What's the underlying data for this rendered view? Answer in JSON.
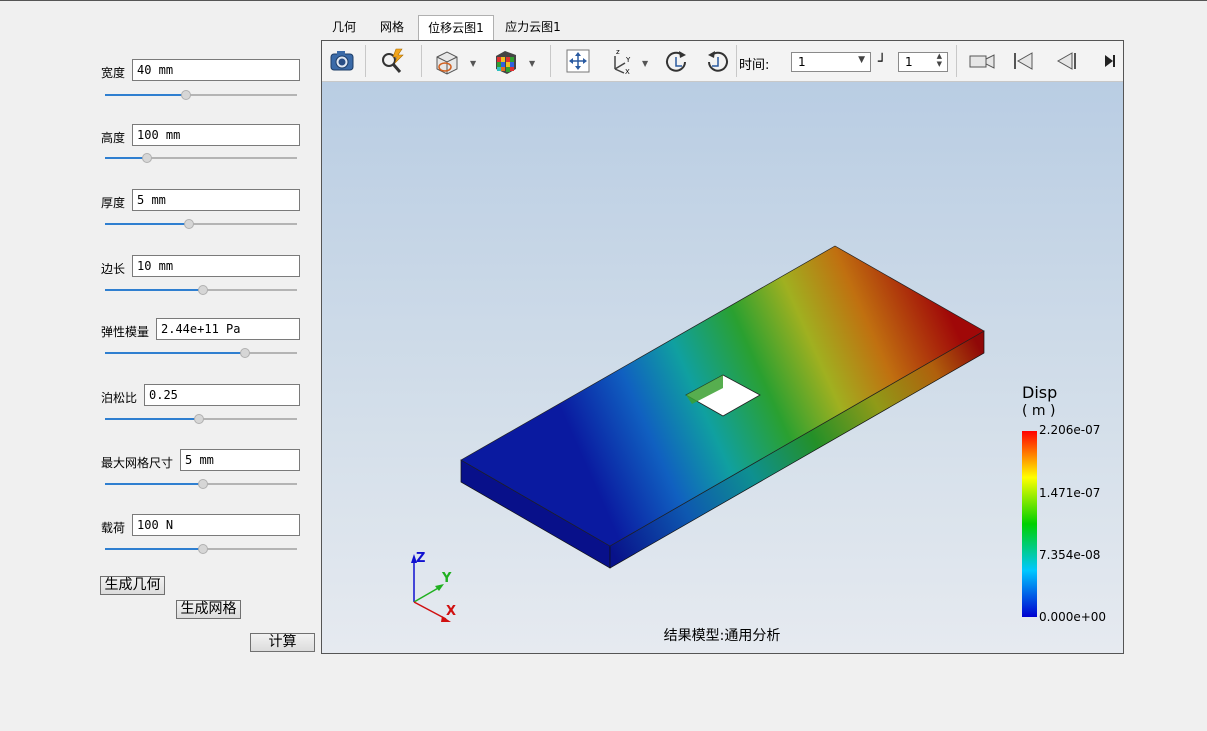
{
  "tabs": [
    {
      "label": "几何"
    },
    {
      "label": "网格"
    },
    {
      "label": "位移云图1"
    },
    {
      "label": "应力云图1"
    }
  ],
  "params": {
    "width": {
      "label": "宽度",
      "value": "40 mm",
      "slider": 0.42
    },
    "height": {
      "label": "高度",
      "value": "100 mm",
      "slider": 0.22
    },
    "thickness": {
      "label": "厚度",
      "value": "5 mm",
      "slider": 0.44
    },
    "side": {
      "label": "边长",
      "value": "10 mm",
      "slider": 0.51
    },
    "modulus": {
      "label": "弹性模量",
      "value": "2.44e+11 Pa",
      "slider": 0.73
    },
    "poisson": {
      "label": "泊松比",
      "value": "0.25",
      "slider": 0.49
    },
    "mesh": {
      "label": "最大网格尺寸",
      "value": "5 mm",
      "slider": 0.51
    },
    "load": {
      "label": "载荷",
      "value": "100 N",
      "slider": 0.51
    }
  },
  "buttons": {
    "gen_geometry": "生成几何",
    "gen_mesh": "生成网格",
    "compute": "计算"
  },
  "toolbar": {
    "time_label": "时间:",
    "time_value": "1",
    "step_value": "1"
  },
  "scene": {
    "caption": "结果模型:通用分析",
    "legend_title": "Disp",
    "legend_unit": "( m )",
    "legend_ticks": [
      "2.206e-07",
      "1.471e-07",
      "7.354e-08",
      "0.000e+00"
    ],
    "axes": {
      "z": "Z",
      "y": "Y",
      "x": "X"
    }
  },
  "colors": {
    "accent": "#2f7fd0",
    "plate_low": "#0a1aa0",
    "plate_high": "#b01010"
  }
}
